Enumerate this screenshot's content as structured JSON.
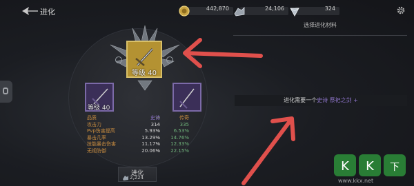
{
  "header": {
    "title": "进化",
    "resources": [
      {
        "icon": "gold-coin-icon",
        "value": "442,870"
      },
      {
        "icon": "ore-icon",
        "value": "24,106"
      },
      {
        "icon": "crystal-icon",
        "value": "324"
      }
    ]
  },
  "right_panel": {
    "header": "选择进化材料",
    "requirement_prefix": "进化需要一个",
    "requirement_item": "史诗 祭祀之剑 +"
  },
  "main_item": {
    "level_label": "等级 40"
  },
  "left_item": {
    "level_label": "等级 40"
  },
  "stats": {
    "header": {
      "name": "品质",
      "current": "史诗",
      "arrow": "→",
      "next": "传奇"
    },
    "rows": [
      {
        "name": "攻击力",
        "current": "314",
        "next": "335"
      },
      {
        "name": "Pvp伤害提高",
        "current": "5.93%",
        "next": "6.53%"
      },
      {
        "name": "暴击几率",
        "current": "13.29%",
        "next": "14.76%"
      },
      {
        "name": "技能暴击伤害",
        "current": "11.17%",
        "next": "12.33%"
      },
      {
        "name": "无视防御",
        "current": "20.06%",
        "next": "22.15%"
      }
    ]
  },
  "evolve_button": {
    "label": "进化",
    "cost": "2,224",
    "cost_icon": "ore-icon"
  },
  "watermark": {
    "url": "www.kkx.net"
  },
  "colors": {
    "epic": "#8c73c7",
    "legend": "#c58a3f",
    "gain": "#6fb27a",
    "arrow": "#e0504c"
  }
}
